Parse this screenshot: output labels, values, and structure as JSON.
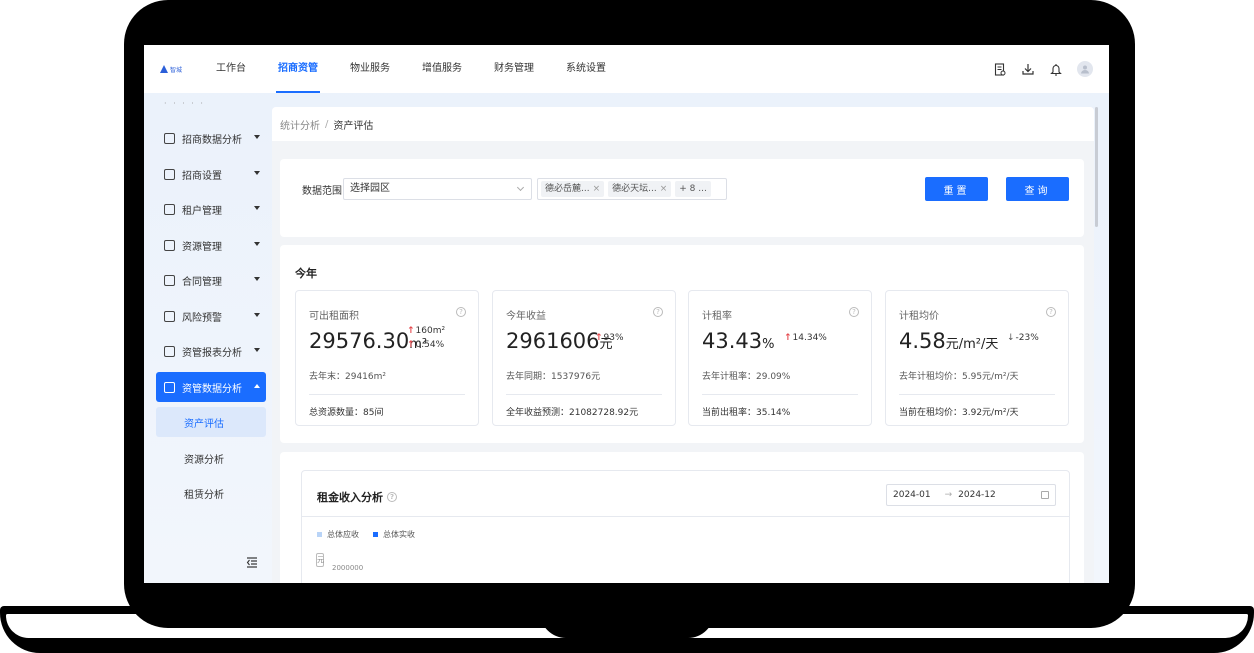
{
  "logo": {
    "text": "智城"
  },
  "nav": {
    "items": [
      {
        "label": "工作台",
        "active": false
      },
      {
        "label": "招商资管",
        "active": true
      },
      {
        "label": "物业服务",
        "active": false
      },
      {
        "label": "增值服务",
        "active": false
      },
      {
        "label": "财务管理",
        "active": false
      },
      {
        "label": "系统设置",
        "active": false
      }
    ]
  },
  "top_icons": [
    "document-icon",
    "download-icon",
    "bell-icon",
    "user-avatar-icon"
  ],
  "sidebar": {
    "cut_text": "· · · · ·",
    "items": [
      {
        "label": "招商数据分析",
        "icon": "chart-icon"
      },
      {
        "label": "招商设置",
        "icon": "settings-doc-icon"
      },
      {
        "label": "租户管理",
        "icon": "tenant-icon"
      },
      {
        "label": "资源管理",
        "icon": "building-icon"
      },
      {
        "label": "合同管理",
        "icon": "contract-icon"
      },
      {
        "label": "风险预警",
        "icon": "alarm-icon"
      },
      {
        "label": "资管报表分析",
        "icon": "report-icon"
      },
      {
        "label": "资管数据分析",
        "icon": "data-chart-icon",
        "active": true
      }
    ],
    "sub_items": [
      {
        "label": "资产评估",
        "active": true
      },
      {
        "label": "资源分析",
        "active": false
      },
      {
        "label": "租赁分析",
        "active": false
      }
    ]
  },
  "breadcrumb": {
    "parent": "统计分析",
    "separator": "/",
    "current": "资产评估"
  },
  "filter": {
    "label": "数据范围",
    "select_value": "选择园区",
    "tags": [
      "德必岳麓...",
      "德必天坛..."
    ],
    "more": "+ 8 ...",
    "reset_label": "重置",
    "query_label": "查询"
  },
  "stats": {
    "title": "今年",
    "cards": [
      {
        "label": "可出租面积",
        "value": "29576.30",
        "unit": "m²",
        "delta1": "160m²",
        "delta2": "0.54%",
        "last": "去年末：29416m²",
        "foot": "总资源数量：85间"
      },
      {
        "label": "今年收益",
        "value": "2961606",
        "unit": "元",
        "delta1": "93%",
        "last": "去年同期：1537976元",
        "foot": "全年收益预测：21082728.92元"
      },
      {
        "label": "计租率",
        "value": "43.43",
        "unit": "%",
        "delta1": "14.34%",
        "last": "去年计租率：29.09%",
        "foot": "当前出租率：35.14%"
      },
      {
        "label": "计租均价",
        "value": "4.58",
        "unit": "元/m²/天",
        "delta1": "-23%",
        "last": "去年计租均价：5.95元/m²/天",
        "foot": "当前在租均价：3.92元/m²/天"
      }
    ]
  },
  "rent": {
    "title": "租金收入分析",
    "date_from": "2024-01",
    "date_arrow": "→",
    "date_to": "2024-12",
    "legend": [
      {
        "name": "总体应收",
        "color": "#b9d4f7"
      },
      {
        "name": "总体实收",
        "color": "#1a6dff"
      }
    ],
    "y_unit": "元",
    "y_tick": "2000000"
  },
  "colors": {
    "primary": "#1a6dff",
    "up": "#e5484d"
  }
}
